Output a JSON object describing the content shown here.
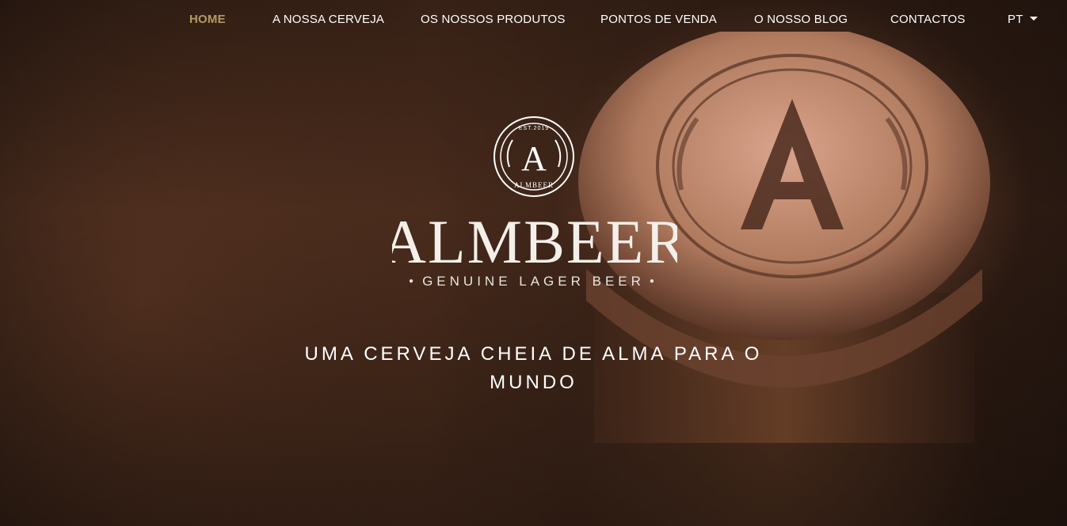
{
  "nav": {
    "items": [
      {
        "label": "HOME",
        "active": true
      },
      {
        "label": "A NOSSA CERVEJA",
        "active": false
      },
      {
        "label": "OS NOSSOS PRODUTOS",
        "active": false
      },
      {
        "label": "PONTOS DE VENDA",
        "active": false
      },
      {
        "label": "O NOSSO BLOG",
        "active": false
      },
      {
        "label": "CONTACTOS",
        "active": false
      }
    ],
    "language": "PT"
  },
  "hero": {
    "logo_wordmark": "ALMBEER",
    "logo_est": "EST.2019",
    "logo_letter": "A",
    "tagline": "GENUINE LAGER BEER",
    "headline": "UMA CERVEJA CHEIA DE ALMA PARA O MUNDO",
    "background": "beer-bottle-cap-photo"
  },
  "colors": {
    "accent": "#b39a62",
    "nav_text": "#ffffff",
    "background": "#3a2418"
  }
}
